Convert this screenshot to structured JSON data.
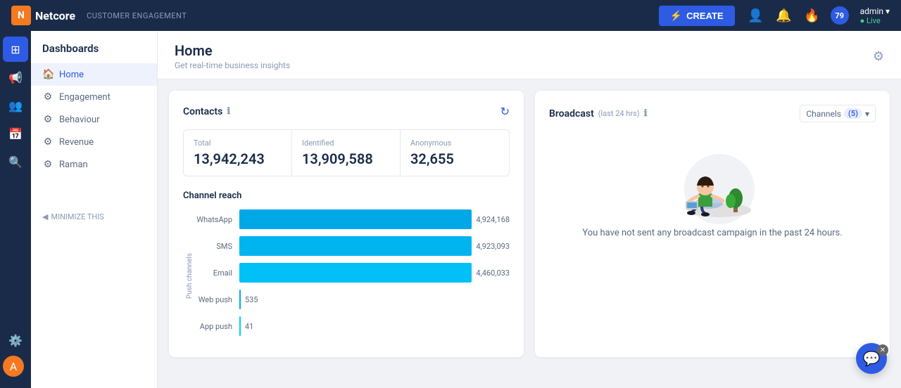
{
  "navbar": {
    "logo_text": "N",
    "brand_name": "Netcore",
    "section": "CUSTOMER ENGAGEMENT",
    "create_label": "CREATE",
    "admin_label": "admin ▾",
    "live_label": "● Live",
    "badge_count": "79"
  },
  "sidebar": {
    "title": "Dashboards",
    "items": [
      {
        "label": "Home",
        "active": true
      },
      {
        "label": "Engagement",
        "active": false
      },
      {
        "label": "Behaviour",
        "active": false
      },
      {
        "label": "Revenue",
        "active": false
      },
      {
        "label": "Raman",
        "active": false
      }
    ],
    "minimize_label": "MINIMIZE THIS"
  },
  "contacts_card": {
    "title": "Contacts",
    "stats": [
      {
        "label": "Total",
        "value": "13,942,243"
      },
      {
        "label": "Identified",
        "value": "13,909,588"
      },
      {
        "label": "Anonymous",
        "value": "32,655"
      }
    ],
    "channel_reach_title": "Channel reach",
    "y_axis_label": "Push channels",
    "bars": [
      {
        "label": "WhatsApp",
        "value": 4924168,
        "display": "4,924,168",
        "width_pct": 95
      },
      {
        "label": "SMS",
        "value": 4923093,
        "display": "4,923,093",
        "width_pct": 95
      },
      {
        "label": "Email",
        "value": 4460033,
        "display": "4,460,033",
        "width_pct": 86
      },
      {
        "label": "Web push",
        "value": 535,
        "display": "535",
        "width_pct": 1
      },
      {
        "label": "App push",
        "value": 41,
        "display": "41",
        "width_pct": 0.5
      }
    ]
  },
  "broadcast_card": {
    "title": "Broadcast",
    "subtitle": "(last 24 hrs)",
    "channels_label": "Channels",
    "channels_count": "(5)",
    "empty_text": "You have not sent any broadcast campaign in the past 24 hours."
  },
  "chat": {
    "icon": "💬"
  }
}
